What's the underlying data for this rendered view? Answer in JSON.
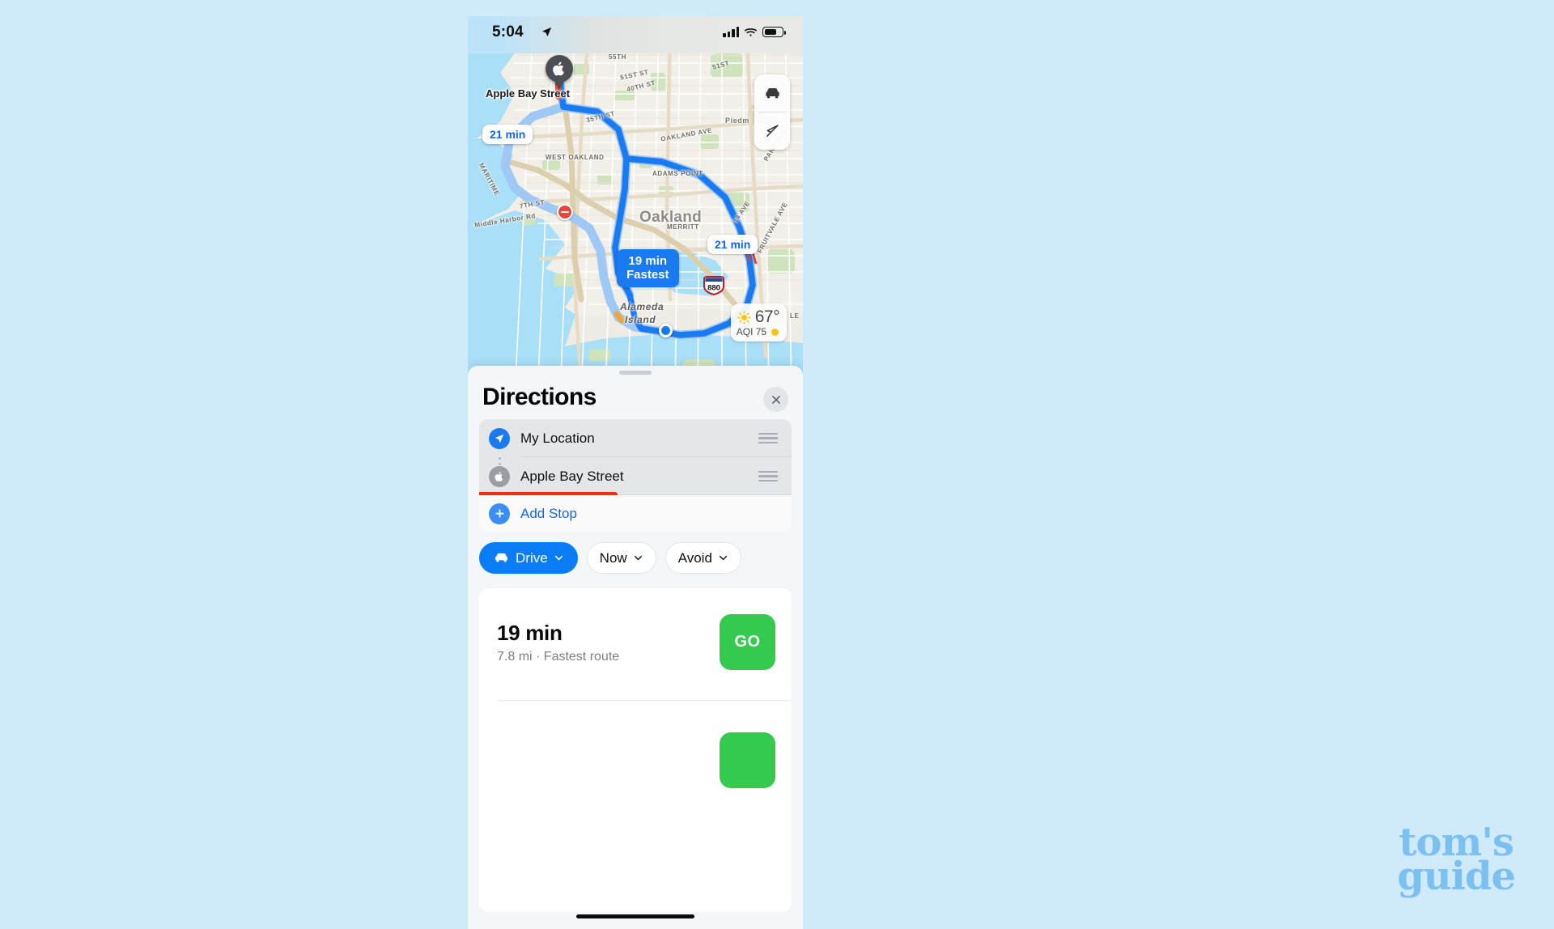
{
  "status_bar": {
    "time": "5:04",
    "location_arrow_icon": "location-arrow-icon",
    "cellular_icon": "cellular-bars-icon",
    "wifi_icon": "wifi-icon",
    "battery_icon": "battery-icon"
  },
  "map": {
    "destination_pin_label": "Apple Bay Street",
    "destination_pin_icon": "apple-logo-pin-icon",
    "origin_icon": "current-location-dot-icon",
    "incident_icon": "road-closure-icon",
    "route_callouts": [
      {
        "id": "alt1",
        "time": "21 min",
        "style": "white"
      },
      {
        "id": "alt2",
        "time": "21 min",
        "style": "white"
      },
      {
        "id": "fastest",
        "time": "19 min",
        "note": "Fastest",
        "style": "blue"
      }
    ],
    "highway_shield": "880",
    "place_labels": [
      "Oakland",
      "WEST OAKLAND",
      "ADAMS POINT",
      "MERRITT",
      "Piedm",
      "Alameda",
      "Island",
      "MARITIME",
      "Middle Harbor Rd",
      "7TH ST",
      "35TH ST",
      "40TH ST",
      "51ST ST",
      "55TH",
      "51ST",
      "OAKLAND AVE",
      "PARK BLV",
      "FRUITVALE AVE",
      "14 AVE",
      "LE"
    ],
    "controls": {
      "transport_icon": "car-icon",
      "locate_icon": "navigation-arrow-icon"
    },
    "weather": {
      "condition_icon": "sun-icon",
      "temperature": "67°",
      "aqi_label": "AQI 75",
      "aqi_dot_color": "#f5c518"
    }
  },
  "sheet": {
    "title": "Directions",
    "close_icon": "close-icon",
    "grabber": "sheet-grabber",
    "route_rows": [
      {
        "icon": "current-location-icon",
        "label": "My Location",
        "handle": "reorder-handle-icon"
      },
      {
        "icon": "apple-logo-icon",
        "label": "Apple Bay Street",
        "handle": "reorder-handle-icon"
      }
    ],
    "add_stop": {
      "icon": "plus-circle-icon",
      "label": "Add Stop",
      "highlight_color": "#ee2b18"
    },
    "options": [
      {
        "name": "mode",
        "icon": "car-icon",
        "label": "Drive",
        "chevron": "chevron-down-icon",
        "active": true
      },
      {
        "name": "time",
        "label": "Now",
        "chevron": "chevron-down-icon",
        "active": false
      },
      {
        "name": "avoid",
        "label": "Avoid",
        "chevron": "chevron-down-icon",
        "active": false
      }
    ],
    "route_card": {
      "duration": "19 min",
      "details": "7.8 mi · Fastest route",
      "go_label": "GO",
      "go_color": "#35ca4f"
    }
  },
  "watermark": {
    "line1": "tom's",
    "line2": "guide"
  }
}
